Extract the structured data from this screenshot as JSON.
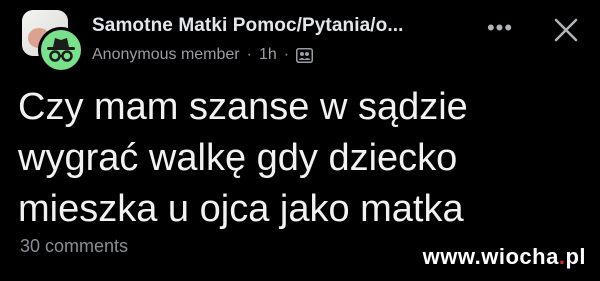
{
  "header": {
    "group_name": "Samotne Matki Pomoc/Pytania/o...",
    "author": "Anonymous member",
    "separator": "·",
    "time": "1h",
    "privacy_icon": "group-members-icon",
    "more_label": "•••",
    "close_icon": "close-icon"
  },
  "post": {
    "lines": [
      "Czy mam szanse w sądzie",
      "wygrać walkę gdy dziecko",
      "mieszka u ojca jako matka"
    ]
  },
  "footer": {
    "comments_label": "30 comments"
  },
  "watermark": {
    "left": "www.wiocha",
    "dot": ".",
    "right": "pl"
  },
  "colors": {
    "background": "#000000",
    "anon_badge": "#79e08c",
    "primary_text": "#f2f2f2",
    "secondary_text": "#9a9ca2"
  }
}
